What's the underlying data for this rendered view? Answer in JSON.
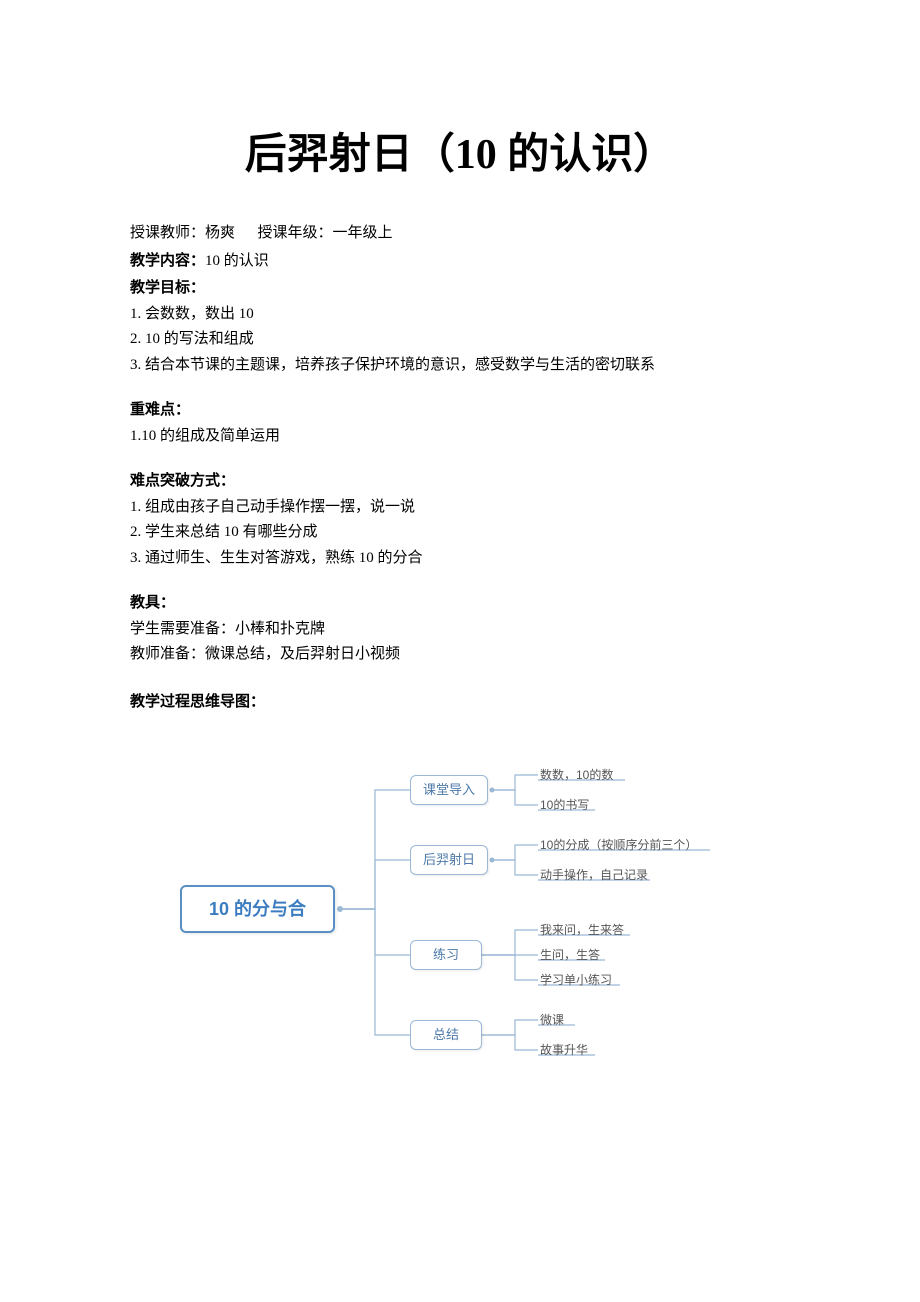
{
  "title": "后羿射日（10 的认识）",
  "meta": {
    "teacher_label": "授课教师：",
    "teacher_value": "杨爽",
    "grade_label": "授课年级：",
    "grade_value": "一年级上"
  },
  "content": {
    "heading": "教学内容：",
    "text": "10 的认识"
  },
  "objectives": {
    "heading": "教学目标：",
    "items": [
      "1.   会数数，数出 10",
      "2.   10 的写法和组成",
      "3.   结合本节课的主题课，培养孩子保护环境的意识，感受数学与生活的密切联系"
    ]
  },
  "keypoints": {
    "heading": "重难点：",
    "items": [
      "1.10 的组成及简单运用"
    ]
  },
  "breakthrough": {
    "heading": "难点突破方式：",
    "items": [
      "1.   组成由孩子自己动手操作摆一摆，说一说",
      "2.   学生来总结 10 有哪些分成",
      "3.   通过师生、生生对答游戏，熟练 10 的分合"
    ]
  },
  "tools": {
    "heading": "教具：",
    "lines": [
      "学生需要准备：小棒和扑克牌",
      "教师准备：微课总结，及后羿射日小视频"
    ]
  },
  "mindmap_heading": "教学过程思维导图：",
  "mindmap": {
    "root": "10 的分与合",
    "nodes": [
      {
        "label": "课堂导入",
        "leaves": [
          "数数，10的数",
          "10的书写"
        ]
      },
      {
        "label": "后羿射日",
        "leaves": [
          "10的分成（按顺序分前三个）",
          "动手操作，自己记录"
        ]
      },
      {
        "label": "练习",
        "leaves": [
          "我来问，生来答",
          "生问，生答",
          "学习单小练习"
        ]
      },
      {
        "label": "总结",
        "leaves": [
          "微课",
          "故事升华"
        ]
      }
    ]
  }
}
